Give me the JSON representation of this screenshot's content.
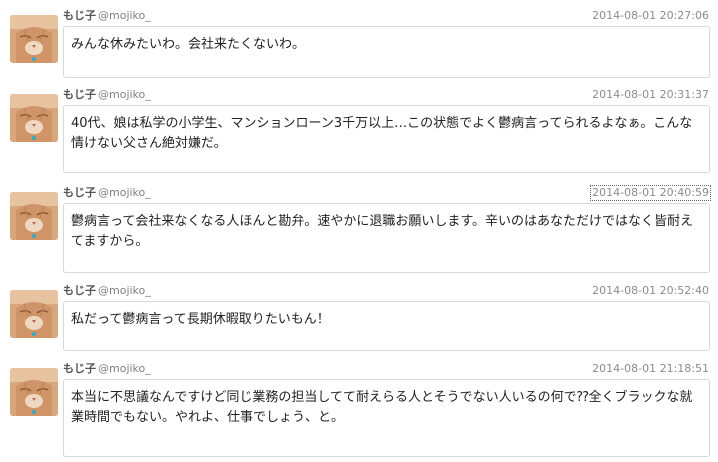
{
  "colors": {
    "avatar_fur": "#d9a77d",
    "bubble_border": "#d8d8d8",
    "timestamp": "#8c8c8c",
    "username": "#555555",
    "handle": "#808080"
  },
  "avatar_icon": "cat-face",
  "posts": [
    {
      "name": "もじ子",
      "handle": "@mojiko_",
      "time": "2014-08-01 20:27:06",
      "text": "みんな休みたいわ。会社来たくないわ。"
    },
    {
      "name": "もじ子",
      "handle": "@mojiko_",
      "time": "2014-08-01 20:31:37",
      "text": "40代、娘は私学の小学生、マンションローン3千万以上…この状態でよく鬱病言ってられるよなぁ。こんな情けない父さん絶対嫌だ。"
    },
    {
      "name": "もじ子",
      "handle": "@mojiko_",
      "time": "2014-08-01 20:40:59",
      "text": "鬱病言って会社来なくなる人ほんと勘弁。速やかに退職お願いします。辛いのはあなただけではなく皆耐えてますから。"
    },
    {
      "name": "もじ子",
      "handle": "@mojiko_",
      "time": "2014-08-01 20:52:40",
      "text": "私だって鬱病言って長期休暇取りたいもん！"
    },
    {
      "name": "もじ子",
      "handle": "@mojiko_",
      "time": "2014-08-01 21:18:51",
      "text": "本当に不思議なんですけど同じ業務の担当してて耐えらる人とそうでない人いるの何で⁇全くブラックな就業時間でもない。やれよ、仕事でしょう、と。"
    }
  ]
}
